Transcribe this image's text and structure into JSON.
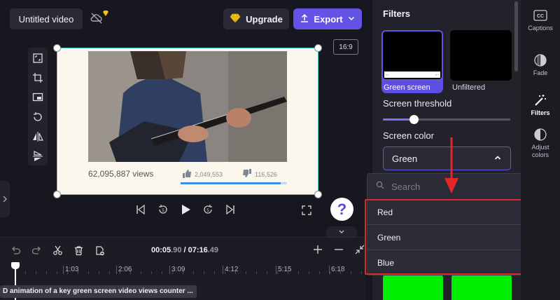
{
  "header": {
    "title": "Untitled video",
    "upgrade_label": "Upgrade",
    "export_label": "Export",
    "aspect_ratio": "16:9"
  },
  "preview": {
    "views": "62,095,887 views",
    "likes": "2,049,553",
    "dislikes": "116,526",
    "like_ratio": 0.94
  },
  "timeline": {
    "current_time_main": "00:05",
    "current_time_frac": ".90",
    "separator": " / ",
    "total_time_main": "07:16",
    "total_time_frac": ".49",
    "ticks": [
      "1:03",
      "2:06",
      "3:09",
      "4:12",
      "5:15",
      "6:18"
    ],
    "clip_title": "D animation of a key green screen video views counter ..."
  },
  "filters_panel": {
    "title": "Filters",
    "filters": [
      {
        "label": "Green screen",
        "selected": true
      },
      {
        "label": "Unfiltered",
        "selected": false
      }
    ],
    "threshold_label": "Screen threshold",
    "threshold_value": 0.24,
    "color_label": "Screen color",
    "color_value": "Green"
  },
  "dropdown": {
    "search_placeholder": "Search",
    "options": [
      "Red",
      "Green",
      "Blue"
    ]
  },
  "rail": {
    "items": [
      {
        "label": "Captions",
        "icon": "captions-icon"
      },
      {
        "label": "Fade",
        "icon": "fade-icon"
      },
      {
        "label": "Filters",
        "icon": "magic-wand-icon"
      },
      {
        "label": "Adjust colors",
        "icon": "adjust-colors-icon"
      }
    ]
  },
  "colors": {
    "accent": "#6454e6",
    "highlight": "#e0282a",
    "chroma_green": "#00ee00",
    "canvas_border": "#44d1c8"
  }
}
